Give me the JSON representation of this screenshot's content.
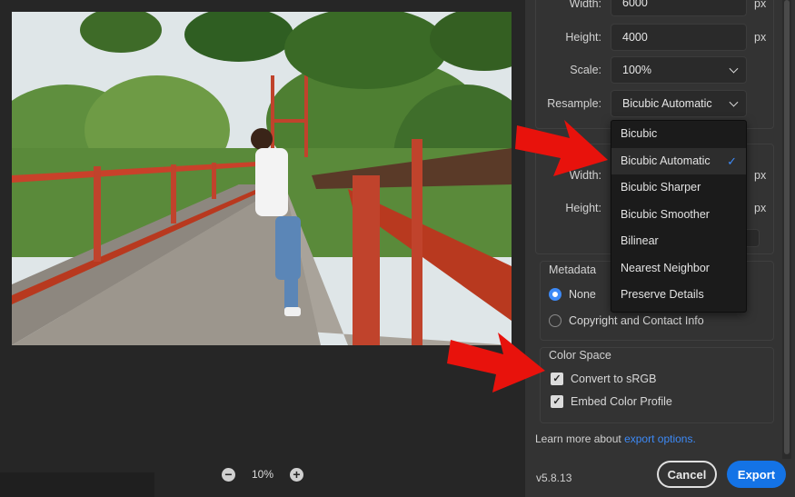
{
  "image_size": {
    "width_label": "Width:",
    "width_value": "6000",
    "height_label": "Height:",
    "height_value": "4000",
    "unit": "px",
    "scale_label": "Scale:",
    "scale_value": "100%",
    "resample_label": "Resample:",
    "resample_value": "Bicubic Automatic"
  },
  "resample_menu": {
    "items": [
      "Bicubic",
      "Bicubic Automatic",
      "Bicubic Sharper",
      "Bicubic Smoother",
      "Bilinear",
      "Nearest Neighbor",
      "Preserve Details"
    ],
    "selected": "Bicubic Automatic",
    "check_glyph": "✓"
  },
  "canvas_size": {
    "width_label": "Width:",
    "height_label": "Height:",
    "unit": "px"
  },
  "metadata": {
    "title": "Metadata",
    "options": [
      {
        "label": "None",
        "checked": true
      },
      {
        "label": "Copyright and Contact Info",
        "checked": false
      }
    ]
  },
  "color_space": {
    "title": "Color Space",
    "options": [
      {
        "label": "Convert to sRGB",
        "checked": true
      },
      {
        "label": "Embed Color Profile",
        "checked": true
      }
    ],
    "check_glyph": "✓"
  },
  "footer": {
    "learn_prefix": "Learn more about",
    "learn_link": "export options.",
    "version": "v5.8.13",
    "cancel_label": "Cancel",
    "export_label": "Export"
  },
  "zoom": {
    "minus": "−",
    "plus": "+",
    "level": "10%"
  },
  "colors": {
    "accent": "#1473e6",
    "check_blue": "#3d8af7",
    "annotation_red": "#e8120c",
    "panel_bg": "#333333",
    "canvas_bg": "#262626"
  }
}
